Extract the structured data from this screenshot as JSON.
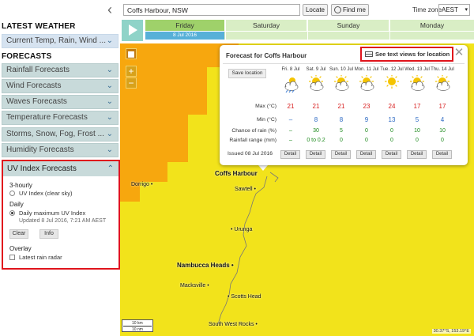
{
  "sidebar": {
    "latest_weather_heading": "LATEST WEATHER",
    "current_item": "Current Temp, Rain, Wind ...",
    "forecasts_heading": "FORECASTS",
    "items": [
      {
        "label": "Rainfall Forecasts"
      },
      {
        "label": "Wind Forecasts"
      },
      {
        "label": "Waves Forecasts"
      },
      {
        "label": "Temperature Forecasts"
      },
      {
        "label": "Storms, Snow, Fog, Frost ..."
      },
      {
        "label": "Humidity Forecasts"
      }
    ],
    "uv": {
      "title": "UV Index Forecasts",
      "three_hourly": "3-hourly",
      "opt_clear_sky": "UV Index (clear sky)",
      "daily": "Daily",
      "opt_daily_max": "Daily maximum UV Index",
      "updated": "Updated 8 Jul 2016, 7:21 AM AEST",
      "clear_btn": "Clear",
      "info_btn": "Info",
      "overlay": "Overlay",
      "latest_radar": "Latest rain radar"
    }
  },
  "topbar": {
    "search_value": "Coffs Harbour, NSW",
    "locate_label": "Locate",
    "findme_label": "Find me",
    "timezone_label": "Time zone",
    "timezone_value": "AEST"
  },
  "timeline": {
    "days": [
      "Friday",
      "Saturday",
      "Sunday",
      "Monday"
    ],
    "current_date": "8 Jul 2016"
  },
  "popup": {
    "title": "Forecast for Coffs Harbour",
    "text_views": "See text views for location",
    "save_location": "Save location",
    "row_labels": {
      "max": "Max (°C)",
      "min": "Min (°C)",
      "chance": "Chance of rain (%)",
      "range": "Rainfall range (mm)"
    },
    "columns": [
      {
        "day": "Fri. 8 Jul",
        "icon": "showers-icon",
        "max": "21",
        "min": "–",
        "chance": "–",
        "range": "–",
        "detail": "Detail"
      },
      {
        "day": "Sat. 9 Jul",
        "icon": "partly-cloudy-icon",
        "max": "21",
        "min": "8",
        "chance": "30",
        "range": "0 to 0.2",
        "detail": "Detail"
      },
      {
        "day": "Sun. 10 Jul",
        "icon": "partly-cloudy-icon",
        "max": "21",
        "min": "8",
        "chance": "5",
        "range": "0",
        "detail": "Detail"
      },
      {
        "day": "Mon. 11 Jul",
        "icon": "partly-cloudy-icon",
        "max": "23",
        "min": "9",
        "chance": "0",
        "range": "0",
        "detail": "Detail"
      },
      {
        "day": "Tue. 12 Jul",
        "icon": "sunny-icon",
        "max": "24",
        "min": "13",
        "chance": "0",
        "range": "0",
        "detail": "Detail"
      },
      {
        "day": "Wed. 13 Jul",
        "icon": "partly-cloudy-icon",
        "max": "17",
        "min": "5",
        "chance": "10",
        "range": "0",
        "detail": "Detail"
      },
      {
        "day": "Thu. 14 Jul",
        "icon": "partly-cloudy-icon",
        "max": "17",
        "min": "4",
        "chance": "10",
        "range": "0",
        "detail": "Detail"
      }
    ],
    "issued": "Issued 08 Jul 2016"
  },
  "map": {
    "places": {
      "dorrigo": "Dorrigo",
      "coffs": "Coffs Harbour",
      "sawtell": "Sawtell",
      "urunga": "Urunga",
      "nambucca": "Nambucca Heads",
      "macksville": "Macksville",
      "scotts": "Scotts Head",
      "swrocks": "South West Rocks"
    },
    "scale_km": "10 km",
    "scale_nm": "10 nm",
    "coordinates": "30.37°S, 153.19°E"
  },
  "colors": {
    "uv_extreme": "#f2e31b",
    "uv_very_high": "#f7a70e",
    "highlight": "#e0141c"
  }
}
